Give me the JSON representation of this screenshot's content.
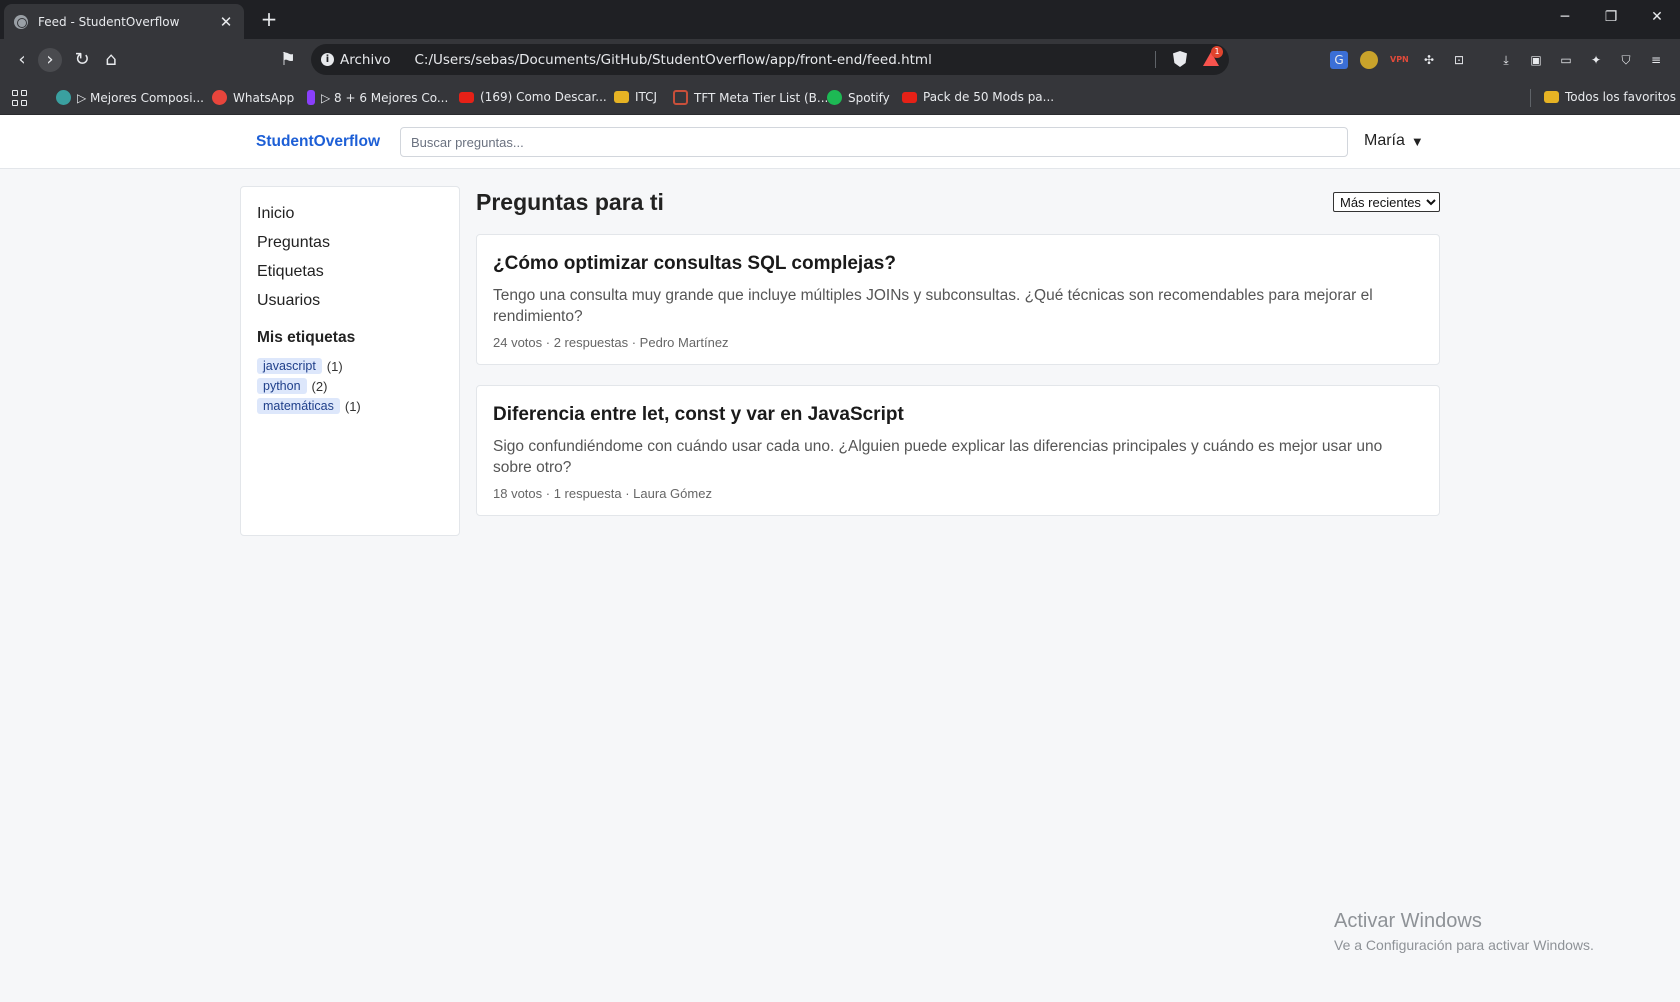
{
  "browser": {
    "tab_title": "Feed - StudentOverflow",
    "address_scheme": "Archivo",
    "address_url": "C:/Users/sebas/Documents/GitHub/StudentOverflow/app/front-end/feed.html",
    "rewards_count": "1",
    "bookmarks": [
      {
        "label": "▷ Mejores Composi...",
        "color": "#3aa0a0"
      },
      {
        "label": "WhatsApp",
        "color": "#e8453c"
      },
      {
        "label": "▷ 8 + 6 Mejores Co...",
        "color": "#8a3ffc"
      },
      {
        "label": "(169) Como Descar...",
        "color": "#e62117"
      },
      {
        "label": "ITCJ",
        "color": "#e6b324"
      },
      {
        "label": "TFT Meta Tier List (B...",
        "color": "#c84f3a"
      },
      {
        "label": "Spotify",
        "color": "#1db954"
      },
      {
        "label": "Pack de 50 Mods pa...",
        "color": "#e62117"
      }
    ],
    "all_bookmarks_label": "Todos los favoritos"
  },
  "app": {
    "brand": "StudentOverflow",
    "search_placeholder": "Buscar preguntas...",
    "user_name": "María",
    "user_caret": "▼",
    "accent_color": "#1d5fd6"
  },
  "sidebar": {
    "links": [
      "Inicio",
      "Preguntas",
      "Etiquetas",
      "Usuarios"
    ],
    "tags_heading": "Mis etiquetas",
    "tags": [
      {
        "name": "javascript",
        "count": "(1)"
      },
      {
        "name": "python",
        "count": "(2)"
      },
      {
        "name": "matemáticas",
        "count": "(1)"
      }
    ]
  },
  "feed": {
    "heading": "Preguntas para ti",
    "sort_selected": "Más recientes",
    "questions": [
      {
        "title": "¿Cómo optimizar consultas SQL complejas?",
        "excerpt": "Tengo una consulta muy grande que incluye múltiples JOINs y subconsultas. ¿Qué técnicas son recomendables para mejorar el rendimiento?",
        "meta": "24 votos · 2 respuestas · Pedro Martínez"
      },
      {
        "title": "Diferencia entre let, const y var en JavaScript",
        "excerpt": "Sigo confundiéndome con cuándo usar cada uno. ¿Alguien puede explicar las diferencias principales y cuándo es mejor usar uno sobre otro?",
        "meta": "18 votos · 1 respuesta · Laura Gómez"
      }
    ]
  },
  "watermark": {
    "line1": "Activar Windows",
    "line2": "Ve a Configuración para activar Windows."
  }
}
